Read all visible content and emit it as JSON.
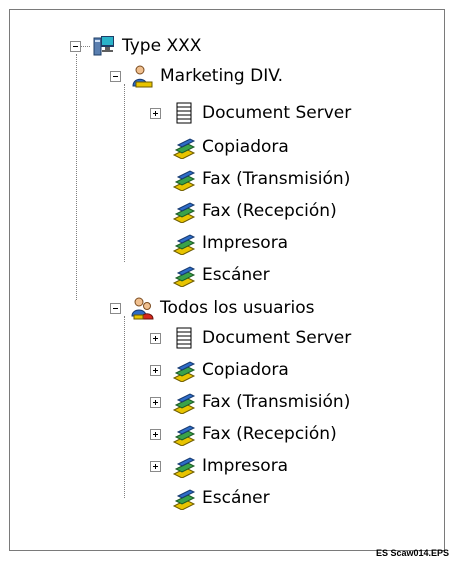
{
  "tree": {
    "root": {
      "label": "Type XXX",
      "icon": "server-computer-icon",
      "expanded": true
    },
    "groups": [
      {
        "label": "Marketing DIV.",
        "icon": "user-group-icon",
        "expanded": true,
        "children": [
          {
            "label": "Document Server",
            "icon": "document-stack-icon",
            "expandable": true,
            "expanded": false
          },
          {
            "label": "Copiadora",
            "icon": "documents-fan-icon",
            "expandable": false
          },
          {
            "label": "Fax (Transmisión)",
            "icon": "documents-fan-icon",
            "expandable": false
          },
          {
            "label": "Fax (Recepción)",
            "icon": "documents-fan-icon",
            "expandable": false
          },
          {
            "label": "Impresora",
            "icon": "documents-fan-icon",
            "expandable": false
          },
          {
            "label": "Escáner",
            "icon": "documents-fan-icon",
            "expandable": false
          }
        ]
      },
      {
        "label": "Todos los usuarios",
        "icon": "all-users-icon",
        "expanded": true,
        "children": [
          {
            "label": "Document Server",
            "icon": "document-stack-icon",
            "expandable": true,
            "expanded": false
          },
          {
            "label": "Copiadora",
            "icon": "documents-fan-icon",
            "expandable": true,
            "expanded": false
          },
          {
            "label": "Fax (Transmisión)",
            "icon": "documents-fan-icon",
            "expandable": true,
            "expanded": false
          },
          {
            "label": "Fax (Recepción)",
            "icon": "documents-fan-icon",
            "expandable": true,
            "expanded": false
          },
          {
            "label": "Impresora",
            "icon": "documents-fan-icon",
            "expandable": true,
            "expanded": false
          },
          {
            "label": "Escáner",
            "icon": "documents-fan-icon",
            "expandable": false
          }
        ]
      }
    ]
  },
  "caption": "ES Scaw014.EPS",
  "colors": {
    "icon_yellow": "#e8c400",
    "icon_green": "#3aa24a",
    "icon_blue": "#2e6cc7",
    "icon_red": "#d8281c"
  }
}
